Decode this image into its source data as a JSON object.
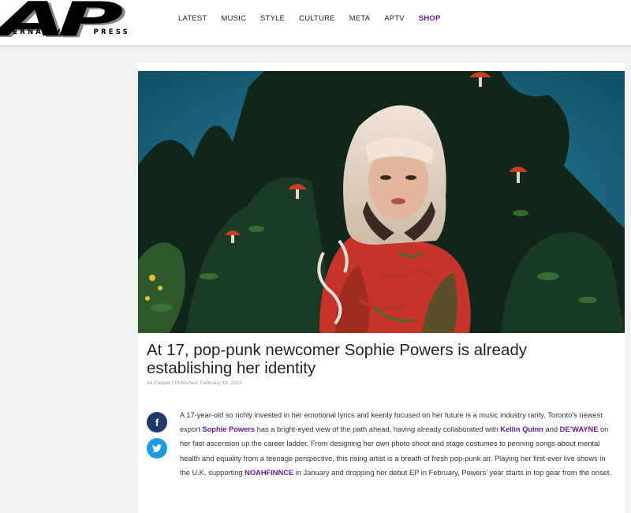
{
  "brand": {
    "logo_text": "AP",
    "logo_subtitle_left": "LTERNATIVE",
    "logo_subtitle_right": "PRESS"
  },
  "nav": {
    "items": [
      {
        "label": "LATEST"
      },
      {
        "label": "MUSIC"
      },
      {
        "label": "STYLE"
      },
      {
        "label": "CULTURE"
      },
      {
        "label": "META"
      },
      {
        "label": "APTV"
      },
      {
        "label": "SHOP"
      }
    ],
    "shop_color": "#6a1b9a"
  },
  "article": {
    "headline": "At 17, pop-punk newcomer Sophie Powers is already establishing her identity",
    "byline": "Ali Cooper | Published: February 16, 2022",
    "body": {
      "t1": "A 17-year-old so richly invested in her emotional lyrics and keenly focused on her future is a music industry rarity. Toronto’s newest export ",
      "link1": "Sophie Powers",
      "t2": " has a bright-eyed view of the path ahead, having already collaborated with ",
      "link2": "Kellin Quinn",
      "t3": " and ",
      "link3": "DE’WAYNE",
      "t4": " on her fast ascension up the career ladder. From designing her own photo shoot and stage costumes to penning songs about mental health and equality from a teenage perspective, this rising artist is a breath of fresh pop-punk air. Playing her first-ever live shows in the U.K. supporting ",
      "link4": "NOAHFINNCE",
      "t5": " in January and dropping her debut EP in February, Powers’ year starts in top gear from the onset."
    },
    "link_color": "#6a1b9a"
  },
  "share": {
    "facebook_glyph": "f",
    "twitter_glyph": "t",
    "facebook_icon": "facebook-icon",
    "twitter_icon": "twitter-icon",
    "facebook_color": "#1f3b6e",
    "twitter_color": "#1b9be0"
  }
}
